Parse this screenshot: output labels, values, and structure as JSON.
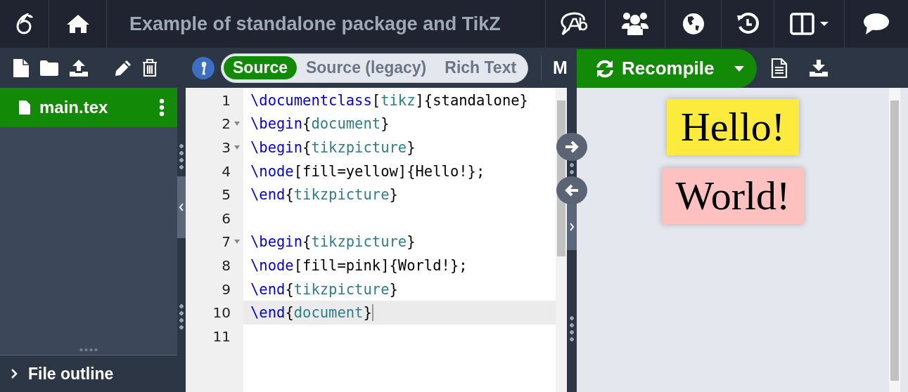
{
  "top_bar": {
    "title": "Example of standalone package and TikZ"
  },
  "toolbar": {
    "editor_modes": [
      {
        "label": "Source",
        "selected": true
      },
      {
        "label": "Source (legacy)",
        "selected": false
      },
      {
        "label": "Rich Text",
        "selected": false
      }
    ],
    "symbol_palette": "M",
    "recompile": "Recompile"
  },
  "file_tree": {
    "items": [
      {
        "name": "main.tex",
        "selected": true
      }
    ]
  },
  "file_outline": {
    "label": "File outline",
    "expanded": false
  },
  "editor": {
    "lines": [
      {
        "number": "1",
        "foldable": false,
        "active": false,
        "tokens": [
          {
            "kind": "command",
            "text": "\\documentclass"
          },
          {
            "kind": "text",
            "text": "["
          },
          {
            "kind": "argument",
            "text": "tikz"
          },
          {
            "kind": "text",
            "text": "]{standalone}"
          }
        ]
      },
      {
        "number": "2",
        "foldable": true,
        "active": false,
        "tokens": [
          {
            "kind": "command",
            "text": "\\begin"
          },
          {
            "kind": "text",
            "text": "{"
          },
          {
            "kind": "argument",
            "text": "document"
          },
          {
            "kind": "text",
            "text": "}"
          }
        ]
      },
      {
        "number": "3",
        "foldable": true,
        "active": false,
        "tokens": [
          {
            "kind": "command",
            "text": "\\begin"
          },
          {
            "kind": "text",
            "text": "{"
          },
          {
            "kind": "argument",
            "text": "tikzpicture"
          },
          {
            "kind": "text",
            "text": "}"
          }
        ]
      },
      {
        "number": "4",
        "foldable": false,
        "active": false,
        "tokens": [
          {
            "kind": "command",
            "text": "\\node"
          },
          {
            "kind": "text",
            "text": "[fill=yellow]{Hello!};"
          }
        ]
      },
      {
        "number": "5",
        "foldable": false,
        "active": false,
        "tokens": [
          {
            "kind": "command",
            "text": "\\end"
          },
          {
            "kind": "text",
            "text": "{"
          },
          {
            "kind": "argument",
            "text": "tikzpicture"
          },
          {
            "kind": "text",
            "text": "}"
          }
        ]
      },
      {
        "number": "6",
        "foldable": false,
        "active": false
      },
      {
        "number": "7",
        "foldable": true,
        "active": false,
        "tokens": [
          {
            "kind": "command",
            "text": "\\begin"
          },
          {
            "kind": "text",
            "text": "{"
          },
          {
            "kind": "argument",
            "text": "tikzpicture"
          },
          {
            "kind": "text",
            "text": "}"
          }
        ]
      },
      {
        "number": "8",
        "foldable": false,
        "active": false,
        "tokens": [
          {
            "kind": "command",
            "text": "\\node"
          },
          {
            "kind": "text",
            "text": "[fill=pink]{World!};"
          }
        ]
      },
      {
        "number": "9",
        "foldable": false,
        "active": false,
        "tokens": [
          {
            "kind": "command",
            "text": "\\end"
          },
          {
            "kind": "text",
            "text": "{"
          },
          {
            "kind": "argument",
            "text": "tikzpicture"
          },
          {
            "kind": "text",
            "text": "}"
          }
        ]
      },
      {
        "number": "10",
        "foldable": false,
        "active": true,
        "tokens": [
          {
            "kind": "command",
            "text": "\\end"
          },
          {
            "kind": "text",
            "text": "{"
          },
          {
            "kind": "argument",
            "text": "document"
          },
          {
            "kind": "text",
            "text": "}"
          }
        ]
      },
      {
        "number": "11",
        "foldable": false,
        "active": false
      }
    ]
  },
  "pdf": {
    "nodes": [
      {
        "text": "Hello!",
        "color": "#fceb3c"
      },
      {
        "text": "World!",
        "color": "#ffc0c0"
      }
    ]
  }
}
